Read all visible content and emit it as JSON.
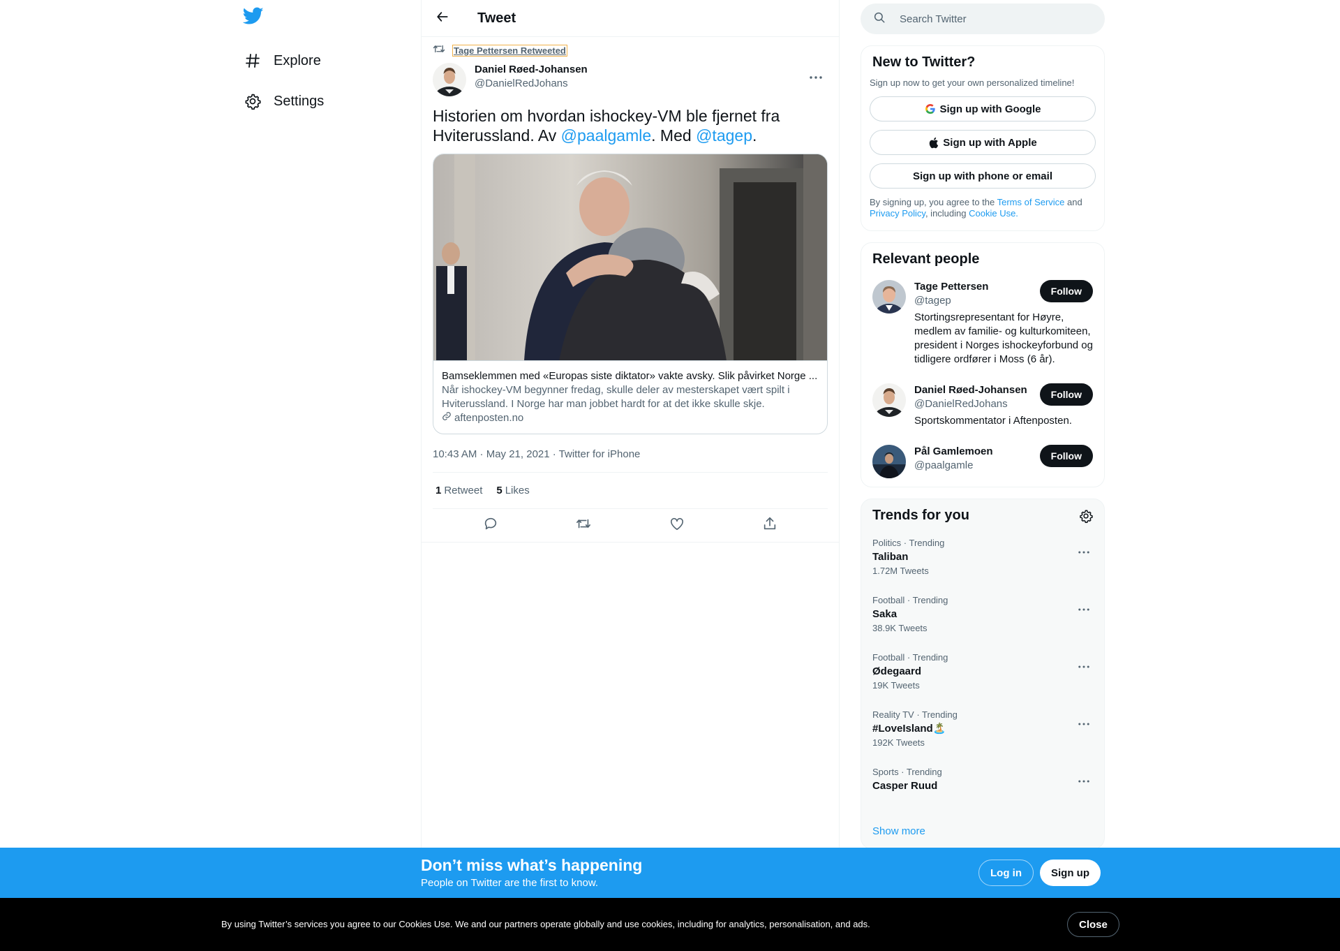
{
  "colors": {
    "accent": "#1d9bf0",
    "text": "#0f1419",
    "muted": "#536471",
    "border": "#eff3f4"
  },
  "nav": {
    "logo_icon": "twitter-bird-icon",
    "items": [
      {
        "label": "Explore",
        "icon": "hashtag-icon"
      },
      {
        "label": "Settings",
        "icon": "gear-icon"
      }
    ]
  },
  "header": {
    "title": "Tweet",
    "back_icon": "arrow-left-icon"
  },
  "tweet": {
    "retweet_context": "Tage Pettersen Retweeted",
    "author_name": "Daniel Røed-Johansen",
    "author_handle": "@DanielRedJohans",
    "text_part1": "Historien om hvordan ishockey-VM ble fjernet fra Hviterussland. Av ",
    "mention1": "@paalgamle",
    "text_part2": ". Med ",
    "mention2": "@tagep",
    "text_part3": ".",
    "card": {
      "title": "Bamseklemmen med «Europas siste diktator» vakte avsky. Slik påvirket Norge ...",
      "description": "Når ishockey-VM begynner fredag, skulle deler av mesterskapet vært spilt i Hviterussland. I Norge har man jobbet hardt for at det ikke skulle skje.",
      "domain": "aftenposten.no"
    },
    "timestamp": "10:43 AM · May 21, 2021 · Twitter for iPhone",
    "retweets_count": "1",
    "retweets_label": "Retweet",
    "likes_count": "5",
    "likes_label": "Likes"
  },
  "search": {
    "placeholder": "Search Twitter"
  },
  "signup_panel": {
    "title": "New to Twitter?",
    "subtitle": "Sign up now to get your own personalized timeline!",
    "google": "Sign up with Google",
    "apple": "Sign up with Apple",
    "phone": "Sign up with phone or email",
    "legal_1": "By signing up, you agree to the ",
    "terms": "Terms of Service",
    "legal_2": " and ",
    "privacy": "Privacy Policy",
    "legal_3": ", including ",
    "cookie": "Cookie Use."
  },
  "relevant": {
    "title": "Relevant people",
    "follow_label": "Follow",
    "people": [
      {
        "name": "Tage Pettersen",
        "handle": "@tagep",
        "bio": "Stortingsrepresentant for Høyre, medlem av familie- og kulturkomiteen, president i Norges ishockeyforbund og tidligere ordfører i Moss (6 år)."
      },
      {
        "name": "Daniel Røed-Johansen",
        "handle": "@DanielRedJohans",
        "bio": "Sportskommentator i Aftenposten."
      },
      {
        "name": "Pål Gamlemoen",
        "handle": "@paalgamle",
        "bio": ""
      }
    ]
  },
  "trends": {
    "title": "Trends for you",
    "items": [
      {
        "meta": "Politics · Trending",
        "name": "Taliban",
        "count": "1.72M Tweets"
      },
      {
        "meta": "Football · Trending",
        "name": "Saka",
        "count": "38.9K Tweets"
      },
      {
        "meta": "Football · Trending",
        "name": "Ødegaard",
        "count": "19K Tweets"
      },
      {
        "meta": "Reality TV · Trending",
        "name": "#LoveIsland🏝️",
        "count": "192K Tweets"
      },
      {
        "meta": "Sports · Trending",
        "name": "Casper Ruud",
        "count": ""
      }
    ],
    "show_more": "Show more"
  },
  "banner": {
    "title": "Don’t miss what’s happening",
    "subtitle": "People on Twitter are the first to know.",
    "login": "Log in",
    "signup": "Sign up"
  },
  "cookie_bar": {
    "text": "By using Twitter’s services you agree to our Cookies Use. We and our partners operate globally and use cookies, including for analytics, personalisation, and ads.",
    "close": "Close"
  }
}
